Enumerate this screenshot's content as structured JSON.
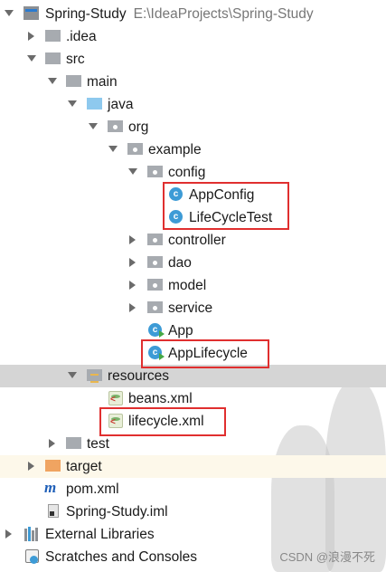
{
  "project": {
    "name": "Spring-Study",
    "path": "E:\\IdeaProjects\\Spring-Study"
  },
  "tree": {
    "idea": ".idea",
    "src": "src",
    "main": "main",
    "java": "java",
    "org": "org",
    "example": "example",
    "config": "config",
    "app_config": "AppConfig",
    "lifecycle_test": "LifeCycleTest",
    "controller": "controller",
    "dao": "dao",
    "model": "model",
    "service": "service",
    "app": "App",
    "app_lifecycle": "AppLifecycle",
    "resources": "resources",
    "beans_xml": "beans.xml",
    "lifecycle_xml": "lifecycle.xml",
    "test": "test",
    "target": "target",
    "pom_xml": "pom.xml",
    "iml": "Spring-Study.iml"
  },
  "external_libraries": "External Libraries",
  "scratches": "Scratches and Consoles",
  "class_icon_letter": "c",
  "watermark": "CSDN @浪漫不死",
  "colors": {
    "highlight_border": "#e02f2f",
    "selected_row": "#d5d5d5",
    "target_row": "#fdf8ea",
    "class_icon": "#3d9bd6"
  }
}
